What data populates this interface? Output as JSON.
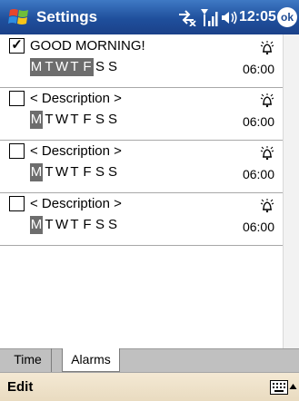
{
  "titlebar": {
    "title": "Settings",
    "clock": "12:05",
    "ok_label": "ok"
  },
  "alarms": [
    {
      "checked": true,
      "description": "GOOD MORNING!",
      "days": [
        {
          "label": "M",
          "on": true
        },
        {
          "label": "T",
          "on": true
        },
        {
          "label": "W",
          "on": true
        },
        {
          "label": "T",
          "on": true
        },
        {
          "label": "F",
          "on": true
        },
        {
          "label": "S",
          "on": false
        },
        {
          "label": "S",
          "on": false
        }
      ],
      "time": "06:00"
    },
    {
      "checked": false,
      "description": "< Description >",
      "days": [
        {
          "label": "M",
          "on": true
        },
        {
          "label": "T",
          "on": false
        },
        {
          "label": "W",
          "on": false
        },
        {
          "label": "T",
          "on": false
        },
        {
          "label": "F",
          "on": false
        },
        {
          "label": "S",
          "on": false
        },
        {
          "label": "S",
          "on": false
        }
      ],
      "time": "06:00"
    },
    {
      "checked": false,
      "description": "< Description >",
      "days": [
        {
          "label": "M",
          "on": true
        },
        {
          "label": "T",
          "on": false
        },
        {
          "label": "W",
          "on": false
        },
        {
          "label": "T",
          "on": false
        },
        {
          "label": "F",
          "on": false
        },
        {
          "label": "S",
          "on": false
        },
        {
          "label": "S",
          "on": false
        }
      ],
      "time": "06:00"
    },
    {
      "checked": false,
      "description": "< Description >",
      "days": [
        {
          "label": "M",
          "on": true
        },
        {
          "label": "T",
          "on": false
        },
        {
          "label": "W",
          "on": false
        },
        {
          "label": "T",
          "on": false
        },
        {
          "label": "F",
          "on": false
        },
        {
          "label": "S",
          "on": false
        },
        {
          "label": "S",
          "on": false
        }
      ],
      "time": "06:00"
    }
  ],
  "check_mark": "✓",
  "tabs": [
    {
      "label": "Time",
      "active": false
    },
    {
      "label": "Alarms",
      "active": true
    }
  ],
  "menubar": {
    "edit_label": "Edit"
  },
  "icons": {
    "start": "windows-logo-icon",
    "connectivity": "connectivity-icon",
    "signal": "signal-icon",
    "volume": "speaker-icon",
    "alarm": "bell-icon",
    "keyboard": "keyboard-icon"
  },
  "colors": {
    "titlebar": "#1f4f9c",
    "day_selected": "#6d6d6d",
    "menubar": "#efe3cb",
    "tabstrip": "#c0c0c0"
  }
}
